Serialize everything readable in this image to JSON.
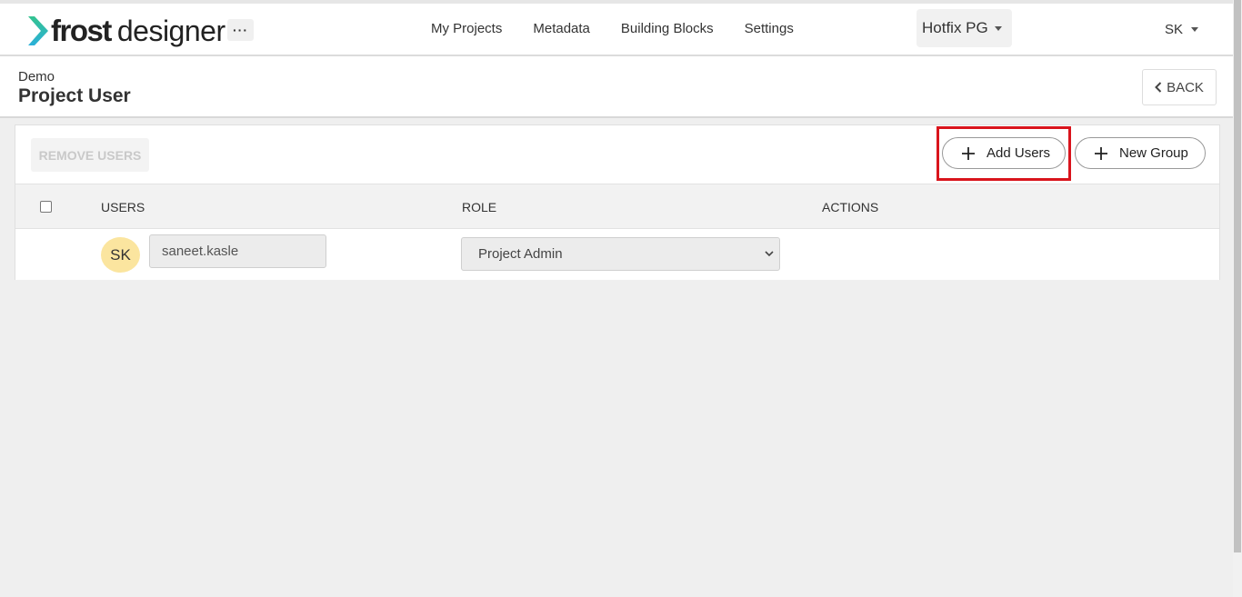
{
  "brand": {
    "name_bold": "frost",
    "name_light": "designer",
    "accent_colors": [
      "#34c38f",
      "#2bb0d9"
    ]
  },
  "nav": {
    "more_label": "···",
    "items": [
      "My Projects",
      "Metadata",
      "Building Blocks",
      "Settings"
    ],
    "org": "Hotfix PG",
    "user": "SK"
  },
  "header": {
    "breadcrumb": "Demo",
    "title": "Project User",
    "back_label": "BACK"
  },
  "toolbar": {
    "remove_label": "REMOVE USERS",
    "add_label": "Add Users",
    "group_label": "New Group",
    "highlight_color": "#d9141c"
  },
  "table": {
    "columns": [
      "USERS",
      "ROLE",
      "ACTIONS"
    ],
    "rows": [
      {
        "initials": "SK",
        "username": "saneet.kasle",
        "role": "Project Admin"
      }
    ]
  }
}
